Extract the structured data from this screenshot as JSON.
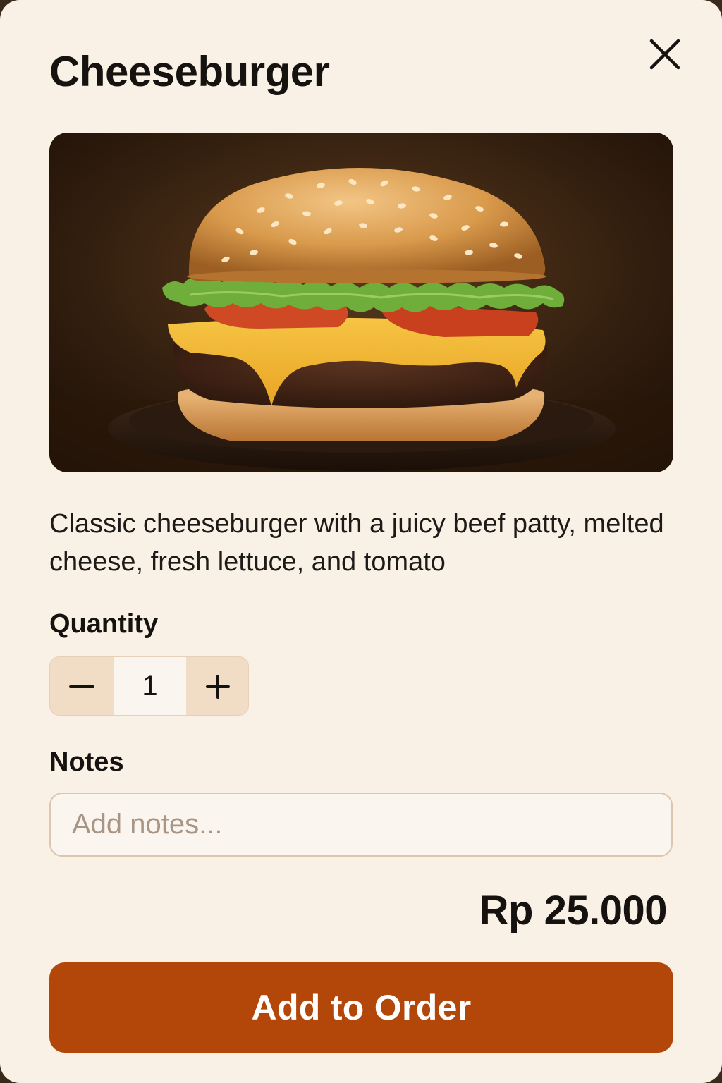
{
  "item": {
    "title": "Cheeseburger",
    "image_subject": "cheeseburger photo",
    "description": "Classic cheeseburger with a juicy beef patty, melted cheese, fresh lettuce, and tomato"
  },
  "quantity": {
    "label": "Quantity",
    "value": "1",
    "decrement_icon": "minus-icon",
    "increment_icon": "plus-icon"
  },
  "notes": {
    "label": "Notes",
    "placeholder": "Add notes...",
    "value": ""
  },
  "price": "Rp 25.000",
  "actions": {
    "add_label": "Add to Order",
    "close_icon": "close-icon"
  },
  "colors": {
    "background": "#f9f0e6",
    "accent": "#b24709",
    "stepper": "#f1dcc6",
    "text": "#151210"
  }
}
